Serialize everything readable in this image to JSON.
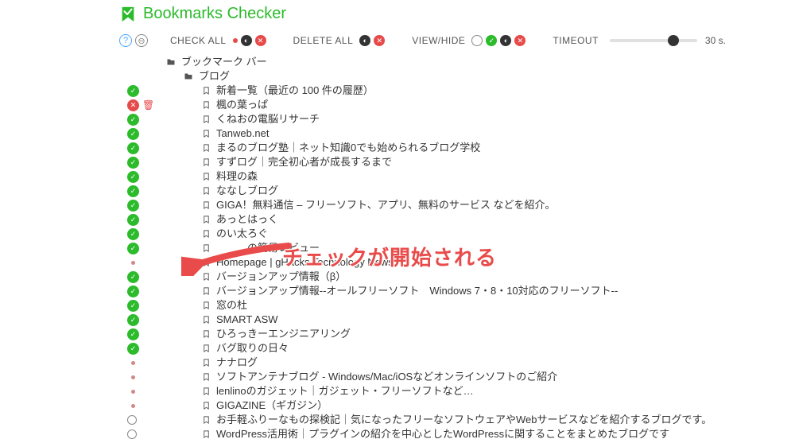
{
  "app": {
    "title": "Bookmarks Checker"
  },
  "toolbar": {
    "checkAll": "CHECK ALL",
    "deleteAll": "DELETE ALL",
    "viewHide": "VIEW/HIDE",
    "timeout": "TIMEOUT",
    "timeoutValue": "30 s."
  },
  "annotation": "チェックが開始される",
  "tree": [
    {
      "status": "",
      "indent": 0,
      "type": "folder",
      "label": "ブックマーク バー"
    },
    {
      "status": "",
      "indent": 1,
      "type": "folder",
      "label": "ブログ"
    },
    {
      "status": "ok",
      "indent": 2,
      "type": "bookmark",
      "label": "新着一覧（最近の 100 件の履歴）"
    },
    {
      "status": "err",
      "indent": 2,
      "type": "bookmark",
      "label": "楓の葉っぱ"
    },
    {
      "status": "ok",
      "indent": 2,
      "type": "bookmark",
      "label": "くねおの電脳リサーチ"
    },
    {
      "status": "ok",
      "indent": 2,
      "type": "bookmark",
      "label": "Tanweb.net"
    },
    {
      "status": "ok",
      "indent": 2,
      "type": "bookmark",
      "label": "まるのブログ塾｜ネット知識0でも始められるブログ学校"
    },
    {
      "status": "ok",
      "indent": 2,
      "type": "bookmark",
      "label": "すずログ｜完全初心者が成長するまで"
    },
    {
      "status": "ok",
      "indent": 2,
      "type": "bookmark",
      "label": "料理の森"
    },
    {
      "status": "ok",
      "indent": 2,
      "type": "bookmark",
      "label": "ななしブログ"
    },
    {
      "status": "ok",
      "indent": 2,
      "type": "bookmark",
      "label": "GIGA！無料通信 – フリーソフト、アプリ、無料のサービス などを紹介。"
    },
    {
      "status": "ok",
      "indent": 2,
      "type": "bookmark",
      "label": "あっとはっく"
    },
    {
      "status": "ok",
      "indent": 2,
      "type": "bookmark",
      "label": "のい太ろぐ"
    },
    {
      "status": "ok",
      "indent": 2,
      "type": "bookmark",
      "label": "　　　の簡易レビュー"
    },
    {
      "status": "dot",
      "indent": 2,
      "type": "bookmark",
      "label": "Homepage | gHacks Technology News"
    },
    {
      "status": "ok",
      "indent": 2,
      "type": "bookmark",
      "label": "バージョンアップ情報（β）"
    },
    {
      "status": "ok",
      "indent": 2,
      "type": "bookmark",
      "label": "バージョンアップ情報--オールフリーソフト　Windows 7・8・10対応のフリーソフト--"
    },
    {
      "status": "ok",
      "indent": 2,
      "type": "bookmark",
      "label": "窓の杜"
    },
    {
      "status": "ok",
      "indent": 2,
      "type": "bookmark",
      "label": "SMART ASW"
    },
    {
      "status": "ok",
      "indent": 2,
      "type": "bookmark",
      "label": "ひろっきーエンジニアリング"
    },
    {
      "status": "ok",
      "indent": 2,
      "type": "bookmark",
      "label": "バグ取りの日々"
    },
    {
      "status": "dot",
      "indent": 2,
      "type": "bookmark",
      "label": "ナナログ"
    },
    {
      "status": "dot",
      "indent": 2,
      "type": "bookmark",
      "label": "ソフトアンテナブログ - Windows/Mac/iOSなどオンラインソフトのご紹介"
    },
    {
      "status": "dot",
      "indent": 2,
      "type": "bookmark",
      "label": "lenlinoのガジェット｜ガジェット・フリーソフトなど…"
    },
    {
      "status": "dot",
      "indent": 2,
      "type": "bookmark",
      "label": "GIGAZINE（ギガジン）"
    },
    {
      "status": "ring",
      "indent": 2,
      "type": "bookmark",
      "label": "お手軽ふりーなもの探検記｜気になったフリーなソフトウェアやWebサービスなどを紹介するブログです。"
    },
    {
      "status": "ring",
      "indent": 2,
      "type": "bookmark",
      "label": "WordPress活用術｜プラグインの紹介を中心としたWordPressに関することをまとめたブログです"
    }
  ]
}
